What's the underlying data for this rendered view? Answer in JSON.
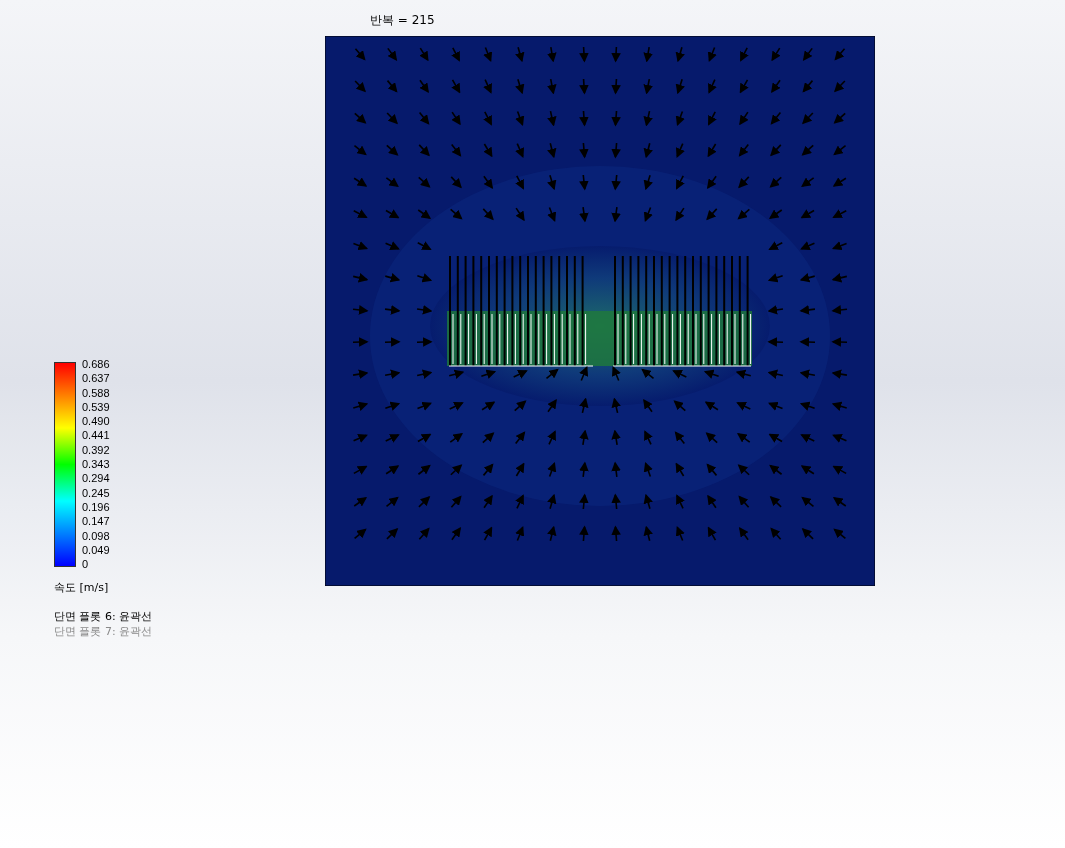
{
  "iteration_label": "반복 = 215",
  "legend": {
    "ticks": [
      "0.686",
      "0.637",
      "0.588",
      "0.539",
      "0.490",
      "0.441",
      "0.392",
      "0.343",
      "0.294",
      "0.245",
      "0.196",
      "0.147",
      "0.098",
      "0.049",
      "0"
    ],
    "unit_label": "속도 [m/s]"
  },
  "plots": [
    {
      "label": "단면 플롯 6: 윤곽선",
      "active": true
    },
    {
      "label": "단면 플롯 7: 윤곽선",
      "active": false
    }
  ]
}
